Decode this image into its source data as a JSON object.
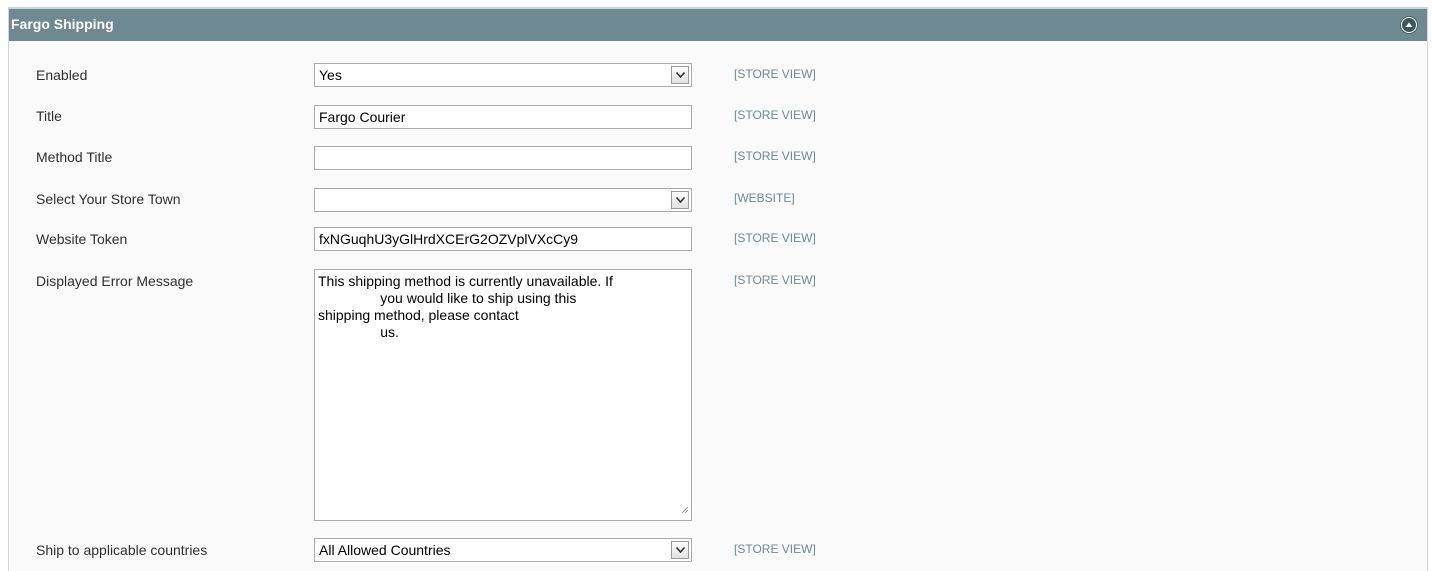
{
  "section": {
    "title": "Fargo Shipping",
    "collapse_icon": "chevron-up-circle-icon"
  },
  "fields": {
    "enabled": {
      "label": "Enabled",
      "value": "Yes",
      "scope": "[STORE VIEW]"
    },
    "title": {
      "label": "Title",
      "value": "Fargo Courier",
      "scope": "[STORE VIEW]"
    },
    "method_title": {
      "label": "Method Title",
      "value": "",
      "scope": "[STORE VIEW]"
    },
    "store_town": {
      "label": "Select Your Store Town",
      "value": "",
      "scope": "[WEBSITE]"
    },
    "website_token": {
      "label": "Website Token",
      "value": "fxNGuqhU3yGlHrdXCErG2OZVplVXcCy9",
      "scope": "[STORE VIEW]"
    },
    "error_message": {
      "label": "Displayed Error Message",
      "value": "This shipping method is currently unavailable. If\n                you would like to ship using this\nshipping method, please contact\n                us.",
      "scope": "[STORE VIEW]"
    },
    "applicable_countries": {
      "label": "Ship to applicable countries",
      "value": "All Allowed Countries",
      "scope": "[STORE VIEW]"
    }
  },
  "colors": {
    "header_bg": "#6f8992",
    "scope_text": "#6f8992",
    "panel_bg": "#fafafa"
  }
}
